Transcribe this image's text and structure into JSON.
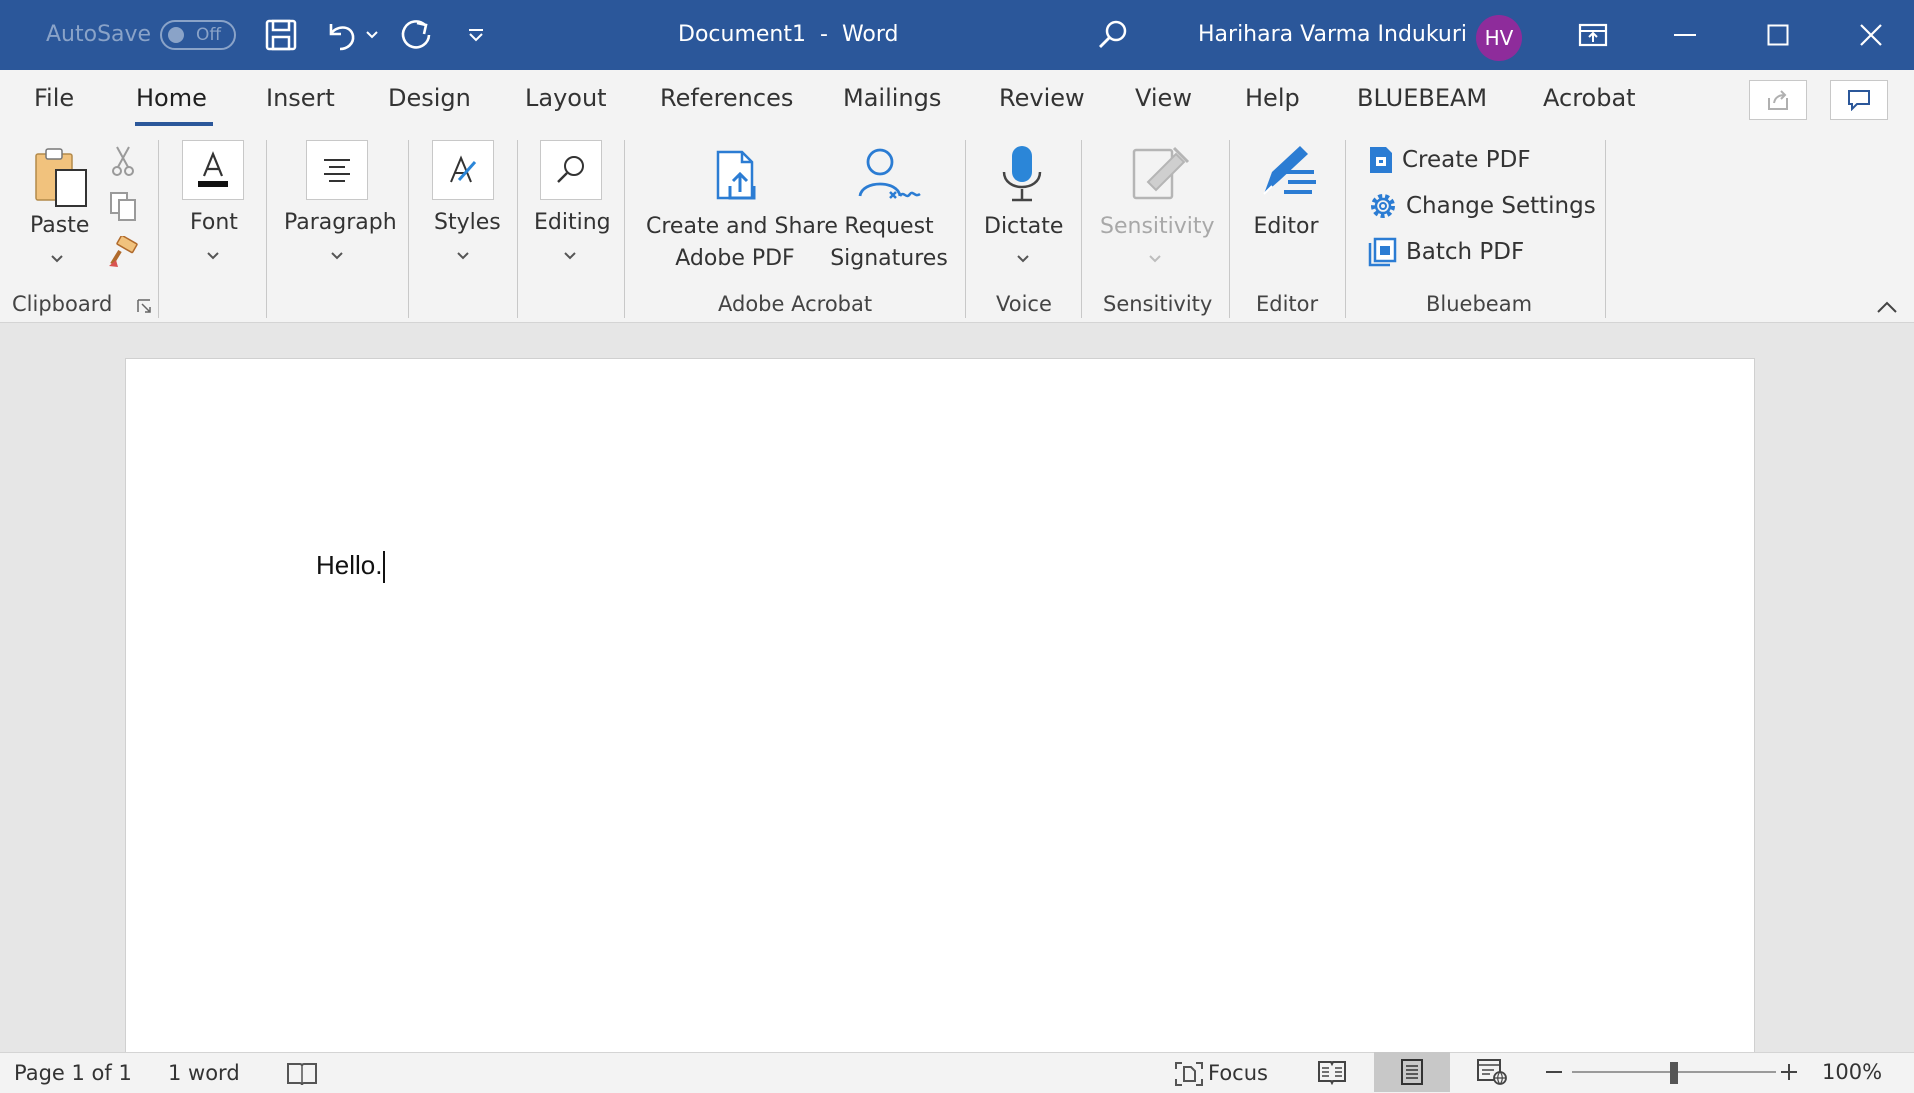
{
  "titlebar": {
    "autosave_label": "AutoSave",
    "autosave_state": "Off",
    "document_name": "Document1",
    "separator": "-",
    "app_name": "Word",
    "user_name": "Harihara Varma Indukuri",
    "user_initials": "HV",
    "colors": {
      "background": "#2b579a",
      "avatar": "#8e2c9b"
    }
  },
  "tabs": [
    {
      "label": "File"
    },
    {
      "label": "Home",
      "active": true
    },
    {
      "label": "Insert"
    },
    {
      "label": "Design"
    },
    {
      "label": "Layout"
    },
    {
      "label": "References"
    },
    {
      "label": "Mailings"
    },
    {
      "label": "Review"
    },
    {
      "label": "View"
    },
    {
      "label": "Help"
    },
    {
      "label": "BLUEBEAM"
    },
    {
      "label": "Acrobat"
    }
  ],
  "ribbon": {
    "clipboard": {
      "paste": "Paste",
      "group": "Clipboard"
    },
    "font": "Font",
    "paragraph": "Paragraph",
    "styles": "Styles",
    "editing": "Editing",
    "acrobat": {
      "create_line1": "Create and Share",
      "create_line2": "Adobe PDF",
      "request_line1": "Request",
      "request_line2": "Signatures",
      "group": "Adobe Acrobat"
    },
    "voice": {
      "dictate": "Dictate",
      "group": "Voice"
    },
    "sensitivity": {
      "button": "Sensitivity",
      "group": "Sensitivity"
    },
    "editor": {
      "button": "Editor",
      "group": "Editor"
    },
    "bluebeam": {
      "create_pdf": "Create PDF",
      "change_settings": "Change Settings",
      "batch_pdf": "Batch PDF",
      "group": "Bluebeam"
    }
  },
  "document": {
    "text": "Hello."
  },
  "statusbar": {
    "page": "Page 1 of 1",
    "words": "1 word",
    "focus": "Focus",
    "zoom": "100%",
    "zoom_level_percent": 100
  }
}
